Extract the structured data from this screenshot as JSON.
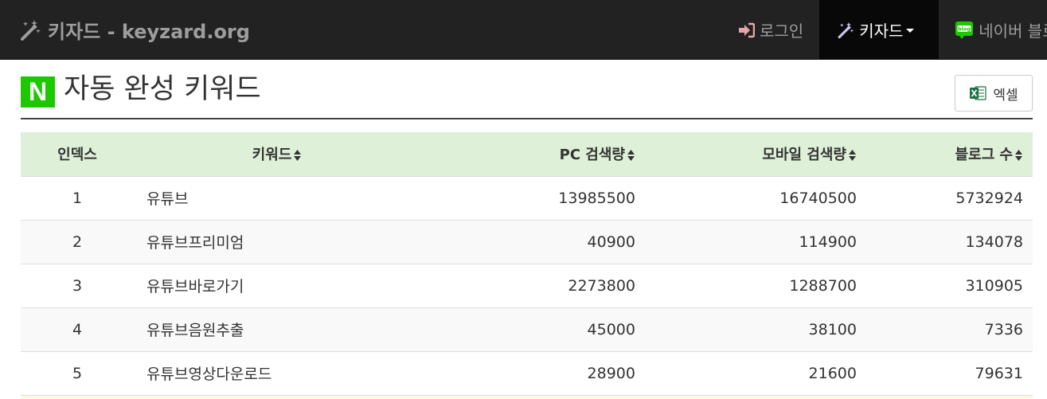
{
  "navbar": {
    "brand": "키자드 - keyzard.org",
    "login_label": "로그인",
    "keyzard_label": "키자드",
    "naver_label": "네이버 블로그"
  },
  "header": {
    "badge": "N",
    "title": "자동 완성 키워드",
    "excel_label": "엑셀"
  },
  "table": {
    "columns": [
      "인덱스",
      "키워드",
      "PC 검색량",
      "모바일 검색량",
      "블로그 수"
    ],
    "rows": [
      [
        "1",
        "유튜브",
        "13985500",
        "16740500",
        "5732924"
      ],
      [
        "2",
        "유튜브프리미엄",
        "40900",
        "114900",
        "134078"
      ],
      [
        "3",
        "유튜브바로가기",
        "2273800",
        "1288700",
        "310905"
      ],
      [
        "4",
        "유튜브음원추출",
        "45000",
        "38100",
        "7336"
      ],
      [
        "5",
        "유튜브영상다운로드",
        "28900",
        "21600",
        "79631"
      ]
    ]
  },
  "colors": {
    "navbar_bg": "#222222",
    "naver_green": "#1ec800",
    "header_row_bg": "#dff0d8",
    "excel_green": "#1d7044"
  },
  "icons": [
    "magic-wand-icon",
    "sign-in-icon",
    "caret-down-icon",
    "blog-icon",
    "excel-icon",
    "sort-icon"
  ]
}
